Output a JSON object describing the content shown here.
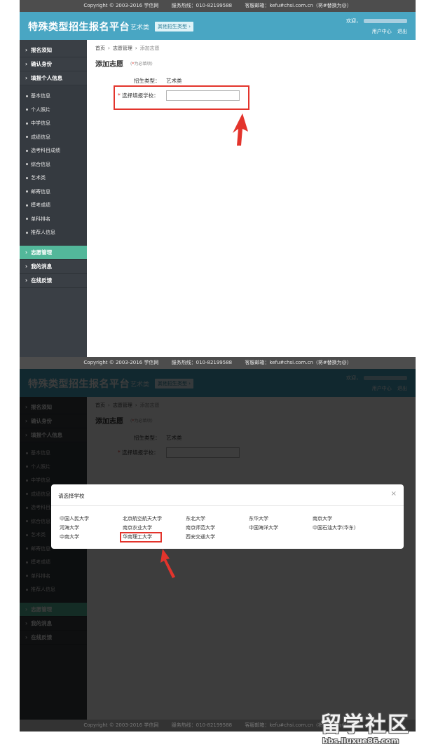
{
  "top_bar": {
    "copyright": "Copyright © 2003-2016 学信网",
    "hotline": "服务热线：010-82199588",
    "email": "客服邮箱：kefu#chsi.com.cn（将#替换为@）"
  },
  "header": {
    "title": "特殊类型招生报名平台",
    "category": "艺术类",
    "other_types_button": "其他招生类型 ›",
    "welcome": "欢迎，",
    "user_center": "用户中心",
    "logout": "退出"
  },
  "sidebar": {
    "sections_top": [
      {
        "label": "报名须知"
      },
      {
        "label": "确认身份"
      },
      {
        "label": "填报个人信息"
      }
    ],
    "subitems": [
      {
        "label": "基本信息"
      },
      {
        "label": "个人照片"
      },
      {
        "label": "中学信息"
      },
      {
        "label": "成绩信息"
      },
      {
        "label": "选考科目成绩"
      },
      {
        "label": "综合信息"
      },
      {
        "label": "艺术类"
      },
      {
        "label": "邮寄信息"
      },
      {
        "label": "模考成绩"
      },
      {
        "label": "单科排名"
      },
      {
        "label": "推荐人信息"
      }
    ],
    "sections_bottom": [
      {
        "label": "志愿管理",
        "active": true
      },
      {
        "label": "我的消息"
      },
      {
        "label": "在线反馈"
      }
    ]
  },
  "breadcrumb": {
    "home": "首页",
    "manage": "志愿管理",
    "current": "添加志愿"
  },
  "form": {
    "title": "添加志愿",
    "required_note": "为必填项",
    "required_star": "*",
    "type_label": "招生类型：",
    "type_value": "艺术类",
    "school_label": "选择填报学校：",
    "school_value": ""
  },
  "modal": {
    "title": "请选择学校",
    "close_icon": "close-icon",
    "schools": [
      [
        "中国人民大学",
        "北京航空航天大学",
        "东北大学",
        "东华大学",
        "南京大学"
      ],
      [
        "河海大学",
        "南京农业大学",
        "南京师范大学",
        "中国海洋大学",
        "中国石油大学(华东)"
      ],
      [
        "中南大学",
        "华南理工大学",
        "西安交通大学"
      ]
    ],
    "highlighted_school": "华南理工大学"
  },
  "watermark": {
    "main": "留学社区",
    "url": "bbs.liuxue86.com"
  },
  "colors": {
    "header_bg": "#49a6c3",
    "sidebar_bg": "#3a3f45",
    "sidebar_active": "#53b79a",
    "highlight": "#e3342c",
    "topbar_bg": "#4d4d4d"
  }
}
